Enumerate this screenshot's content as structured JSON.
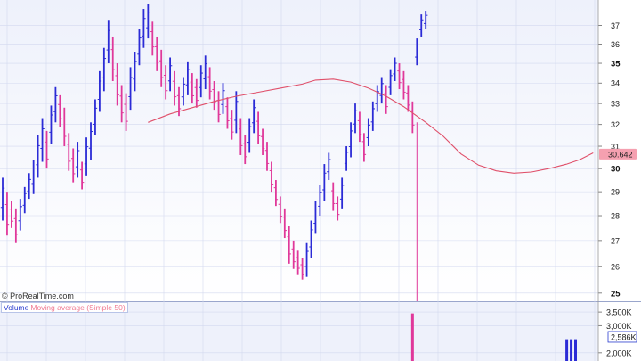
{
  "watermark": "© ProRealTime.com",
  "legend": {
    "volume_label": "Volume",
    "ma_label": "Moving average (Simple 50)"
  },
  "colors": {
    "up": "#2b2bd6",
    "down": "#e0389a",
    "ma_line": "#e0506a",
    "background_top": "#eef1fb",
    "background_bottom": "#ffffff",
    "grid": "#d3d9ef",
    "last_price_box": "#f5a0b0"
  },
  "chart_data": [
    {
      "type": "ohlc",
      "scale": "log",
      "ylim": [
        24.8,
        38.2
      ],
      "y_ticks": [
        25,
        26,
        27,
        28,
        29,
        30,
        31,
        32,
        33,
        34,
        35,
        36,
        37
      ],
      "major_ticks": [
        25,
        30,
        35
      ],
      "last_price": "30.642",
      "grid": true,
      "bars": [
        [
          29.6,
          27.8
        ],
        [
          29.0,
          27.2
        ],
        [
          28.6,
          27.5
        ],
        [
          28.3,
          26.9
        ],
        [
          28.7,
          27.4
        ],
        [
          29.2,
          28.1
        ],
        [
          29.8,
          28.7
        ],
        [
          30.4,
          28.9
        ],
        [
          31.5,
          29.6
        ],
        [
          32.3,
          30.3
        ],
        [
          31.7,
          30.0
        ],
        [
          32.9,
          31.1
        ],
        [
          33.8,
          32.1
        ],
        [
          33.4,
          31.9
        ],
        [
          32.8,
          31.0
        ],
        [
          31.6,
          29.9
        ],
        [
          30.9,
          29.4
        ],
        [
          31.2,
          29.6
        ],
        [
          30.3,
          29.1
        ],
        [
          31.4,
          29.7
        ],
        [
          32.1,
          30.4
        ],
        [
          33.2,
          31.5
        ],
        [
          34.6,
          32.6
        ],
        [
          35.8,
          33.6
        ],
        [
          37.3,
          35.0
        ],
        [
          36.4,
          34.1
        ],
        [
          35.0,
          32.9
        ],
        [
          33.9,
          32.1
        ],
        [
          33.5,
          31.7
        ],
        [
          34.8,
          32.7
        ],
        [
          35.6,
          33.6
        ],
        [
          36.8,
          34.9
        ],
        [
          37.9,
          35.8
        ],
        [
          38.2,
          36.3
        ],
        [
          37.2,
          35.4
        ],
        [
          36.4,
          34.6
        ],
        [
          35.7,
          33.8
        ],
        [
          34.9,
          33.2
        ],
        [
          35.3,
          33.6
        ],
        [
          34.6,
          32.9
        ],
        [
          33.8,
          32.4
        ],
        [
          34.3,
          32.9
        ],
        [
          35.1,
          33.4
        ],
        [
          34.5,
          33.0
        ],
        [
          34.2,
          32.8
        ],
        [
          34.9,
          33.3
        ],
        [
          35.4,
          33.7
        ],
        [
          34.8,
          33.2
        ],
        [
          34.1,
          32.7
        ],
        [
          33.6,
          32.1
        ],
        [
          34.0,
          32.5
        ],
        [
          33.3,
          31.8
        ],
        [
          32.7,
          31.3
        ],
        [
          33.6,
          31.6
        ],
        [
          32.3,
          30.6
        ],
        [
          31.5,
          30.2
        ],
        [
          32.3,
          30.7
        ],
        [
          33.2,
          31.6
        ],
        [
          32.6,
          31.1
        ],
        [
          31.8,
          30.6
        ],
        [
          31.2,
          29.9
        ],
        [
          30.3,
          29.0
        ],
        [
          29.5,
          28.4
        ],
        [
          28.8,
          27.7
        ],
        [
          28.3,
          27.1
        ],
        [
          27.6,
          26.1
        ],
        [
          27.0,
          25.9
        ],
        [
          26.6,
          25.7
        ],
        [
          26.3,
          25.5
        ],
        [
          26.9,
          25.6
        ],
        [
          27.8,
          26.3
        ],
        [
          28.6,
          27.3
        ],
        [
          29.3,
          28.0
        ],
        [
          30.2,
          28.6
        ],
        [
          30.7,
          29.5
        ],
        [
          29.4,
          28.2
        ],
        [
          28.8,
          27.8
        ],
        [
          29.6,
          28.3
        ],
        [
          31.0,
          29.9
        ],
        [
          32.1,
          30.5
        ],
        [
          33.0,
          31.6
        ],
        [
          32.6,
          31.2
        ],
        [
          31.6,
          30.3
        ],
        [
          32.3,
          31.0
        ],
        [
          33.1,
          31.7
        ],
        [
          33.9,
          32.6
        ],
        [
          34.3,
          33.0
        ],
        [
          33.9,
          32.5
        ],
        [
          34.7,
          33.4
        ],
        [
          35.3,
          34.1
        ],
        [
          35.0,
          33.7
        ],
        [
          34.6,
          33.2
        ],
        [
          33.9,
          32.6
        ],
        [
          33.1,
          31.6
        ],
        [
          36.3,
          34.9
        ],
        [
          37.6,
          36.4
        ],
        [
          37.8,
          36.8
        ]
      ],
      "moving_average": [
        [
          33,
          32.1
        ],
        [
          38,
          32.5
        ],
        [
          43,
          32.8
        ],
        [
          48,
          33.1
        ],
        [
          53,
          33.35
        ],
        [
          58,
          33.55
        ],
        [
          63,
          33.75
        ],
        [
          68,
          33.95
        ],
        [
          71,
          34.15
        ],
        [
          75,
          34.2
        ],
        [
          79,
          34.05
        ],
        [
          83,
          33.75
        ],
        [
          87,
          33.35
        ],
        [
          91,
          32.85
        ],
        [
          96,
          32.1
        ],
        [
          100,
          31.45
        ],
        [
          104,
          30.65
        ],
        [
          108,
          30.15
        ],
        [
          112,
          29.9
        ],
        [
          116,
          29.8
        ],
        [
          120,
          29.85
        ],
        [
          124,
          30.0
        ],
        [
          128,
          30.2
        ],
        [
          131,
          30.4
        ],
        [
          134,
          30.7
        ]
      ]
    },
    {
      "type": "bar",
      "series_label": "Volume",
      "y_ticks": [
        "3,500K",
        "3,000K",
        "2,000K"
      ],
      "last_value_label": "2,586K",
      "bars": [
        [
          93,
          3450
        ],
        [
          128,
          2500
        ],
        [
          129,
          2500
        ],
        [
          130,
          2500
        ]
      ],
      "ylim": [
        1700,
        3700
      ]
    }
  ]
}
